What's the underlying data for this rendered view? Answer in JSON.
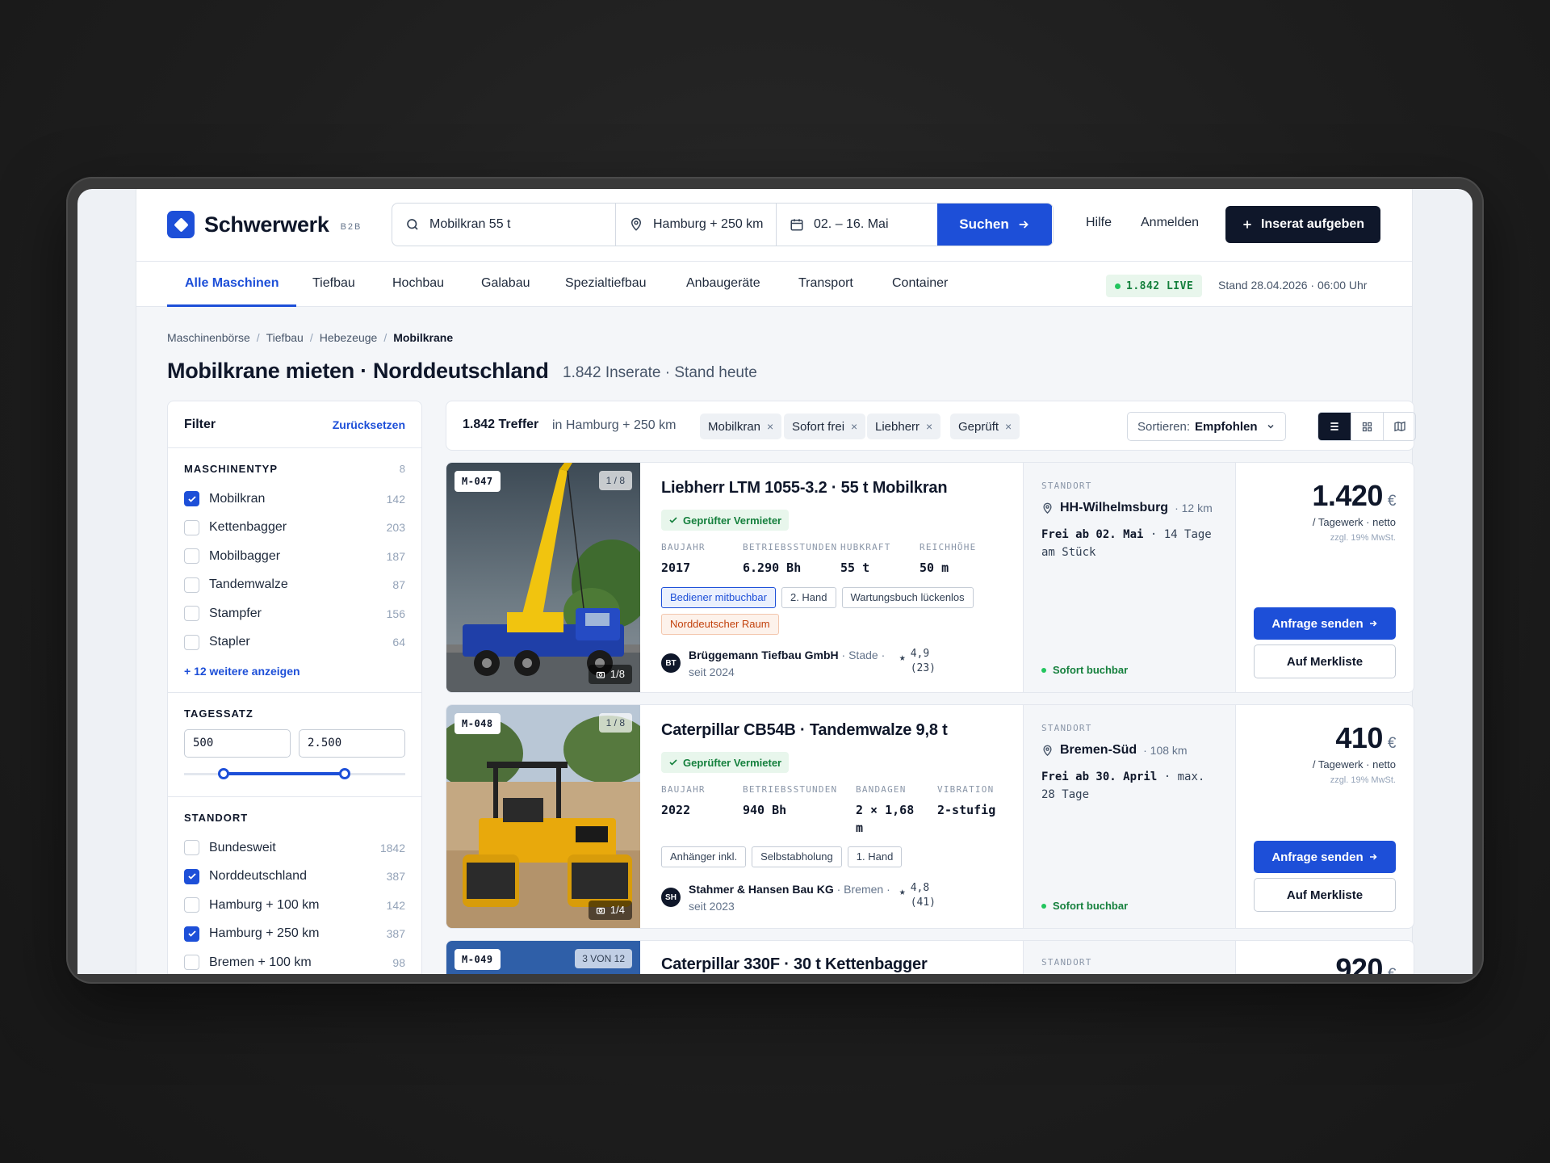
{
  "brand": {
    "name": "Schwerwerk",
    "badge": "B2B"
  },
  "search": {
    "query": "Mobilkran 55 t",
    "location": "Hamburg + 250 km",
    "dates": "02. – 16. Mai",
    "button": "Suchen"
  },
  "header": {
    "help": "Hilfe",
    "login": "Anmelden",
    "cta": "Inserat aufgeben"
  },
  "nav": {
    "tabs": [
      "Alle Maschinen",
      "Tiefbau",
      "Hochbau",
      "Galabau",
      "Spezialtiefbau",
      "Anbaugeräte",
      "Transport",
      "Container"
    ],
    "live": "1.842 LIVE",
    "stand": "Stand 28.04.2026 · 06:00 Uhr"
  },
  "breadcrumb": [
    "Maschinenbörse",
    "Tiefbau",
    "Hebezeuge",
    "Mobilkrane"
  ],
  "page": {
    "title": "Mobilkrane mieten · Norddeutschland",
    "subtitle": "1.842 Inserate · Stand heute"
  },
  "filter": {
    "title": "Filter",
    "reset": "Zurücksetzen",
    "type": {
      "label": "MASCHINENTYP",
      "count": "8",
      "items": [
        {
          "label": "Mobilkran",
          "count": "142",
          "checked": true
        },
        {
          "label": "Kettenbagger",
          "count": "203",
          "checked": false
        },
        {
          "label": "Mobilbagger",
          "count": "187",
          "checked": false
        },
        {
          "label": "Tandemwalze",
          "count": "87",
          "checked": false
        },
        {
          "label": "Stampfer",
          "count": "156",
          "checked": false
        },
        {
          "label": "Stapler",
          "count": "64",
          "checked": false
        }
      ],
      "more": "+ 12 weitere anzeigen"
    },
    "rate": {
      "label": "TAGESSATZ",
      "min": "500",
      "max": "2.500"
    },
    "location": {
      "label": "STANDORT",
      "items": [
        {
          "label": "Bundesweit",
          "count": "1842",
          "checked": false
        },
        {
          "label": "Norddeutschland",
          "count": "387",
          "checked": true
        },
        {
          "label": "Hamburg + 100 km",
          "count": "142",
          "checked": false
        },
        {
          "label": "Hamburg + 250 km",
          "count": "387",
          "checked": true
        },
        {
          "label": "Bremen + 100 km",
          "count": "98",
          "checked": false
        }
      ]
    }
  },
  "results": {
    "count": "1.842 Treffer",
    "in": "in Hamburg + 250 km",
    "chips": [
      "Mobilkran",
      "Sofort frei",
      "Liebherr",
      "Geprüft"
    ],
    "sort_label": "Sortieren:",
    "sort_value": "Empfohlen"
  },
  "cards": [
    {
      "id": "M-047",
      "photos": "1 / 8",
      "cam": "1/8",
      "title": "Liebherr LTM 1055-3.2 · 55 t Mobilkran",
      "verified": "Geprüfter Vermieter",
      "specs": [
        {
          "k": "BAUJAHR",
          "v": "2017"
        },
        {
          "k": "BETRIEBSSTUNDEN",
          "v": "6.290 Bh"
        },
        {
          "k": "HUBKRAFT",
          "v": "55 t"
        },
        {
          "k": "REICHHÖHE",
          "v": "50 m"
        }
      ],
      "tags": [
        "Bediener mitbuchbar",
        "2. Hand",
        "Wartungsbuch lückenlos",
        "Norddeutscher Raum"
      ],
      "seller": {
        "initials": "BT",
        "name": "Brüggemann Tiefbau GmbH",
        "meta": "· Stade · seit 2024",
        "rating": "4,9",
        "reviews": "(23)"
      },
      "loc_label": "STANDORT",
      "place": "HH-Wilhelmsburg",
      "dist": "· 12 km",
      "avail_b": "Frei ab 02. Mai",
      "avail": "· 14 Tage am Stück",
      "bookable": "Sofort buchbar",
      "price": "1.420",
      "cur": "€",
      "unit": "/ Tagewerk · netto",
      "note": "zzgl. 19% MwSt.",
      "req": "Anfrage senden",
      "save": "Auf Merkliste"
    },
    {
      "id": "M-048",
      "photos": "1 / 8",
      "cam": "1/4",
      "title": "Caterpillar CB54B · Tandemwalze 9,8 t",
      "verified": "Geprüfter Vermieter",
      "specs": [
        {
          "k": "BAUJAHR",
          "v": "2022"
        },
        {
          "k": "BETRIEBSSTUNDEN",
          "v": "940 Bh"
        },
        {
          "k": "BANDAGEN",
          "v": "2 × 1,68 m"
        },
        {
          "k": "VIBRATION",
          "v": "2-stufig"
        }
      ],
      "tags": [
        "Anhänger inkl.",
        "Selbstabholung",
        "1. Hand"
      ],
      "seller": {
        "initials": "SH",
        "name": "Stahmer & Hansen Bau KG",
        "meta": "· Bremen · seit 2023",
        "rating": "4,8",
        "reviews": "(41)"
      },
      "loc_label": "STANDORT",
      "place": "Bremen-Süd",
      "dist": "· 108 km",
      "avail_b": "Frei ab 30. April",
      "avail": "· max. 28 Tage",
      "bookable": "Sofort buchbar",
      "price": "410",
      "cur": "€",
      "unit": "/ Tagewerk · netto",
      "note": "zzgl. 19% MwSt.",
      "req": "Anfrage senden",
      "save": "Auf Merkliste"
    },
    {
      "id": "M-049",
      "photos": "3 VON 12",
      "title": "Caterpillar 330F · 30 t Kettenbagger",
      "loc_label": "STANDORT",
      "price": "920",
      "cur": "€"
    }
  ],
  "colors": {
    "accent": "#1d4fd8",
    "dark": "#0f172a",
    "success": "#15803d"
  }
}
